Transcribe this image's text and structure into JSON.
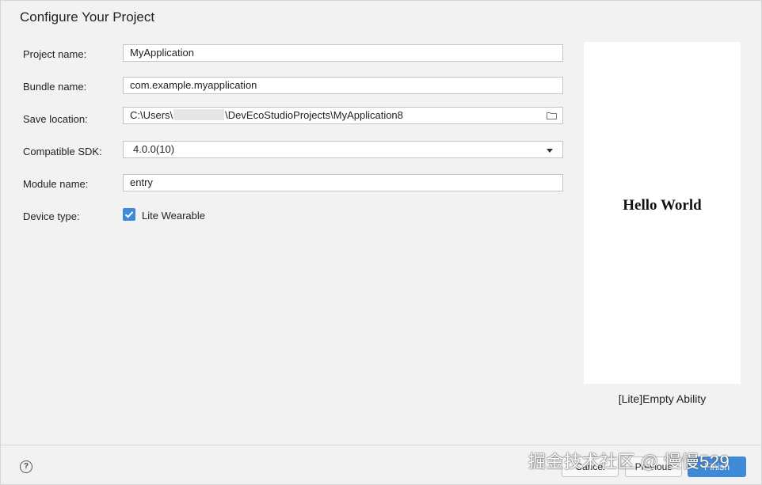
{
  "dialog": {
    "title": "Configure Your Project"
  },
  "form": {
    "project_name": {
      "label": "Project name:",
      "value": "MyApplication"
    },
    "bundle_name": {
      "label": "Bundle name:",
      "value": "com.example.myapplication"
    },
    "save_location": {
      "label": "Save location:",
      "value_prefix": "C:\\Users\\",
      "value_suffix": "\\DevEcoStudioProjects\\MyApplication8"
    },
    "compatible_sdk": {
      "label": "Compatible SDK:",
      "value": "4.0.0(10)"
    },
    "module_name": {
      "label": "Module name:",
      "value": "entry"
    },
    "device_type": {
      "label": "Device type:",
      "option": "Lite Wearable",
      "checked": true
    }
  },
  "preview": {
    "text": "Hello World",
    "caption": "[Lite]Empty Ability"
  },
  "footer": {
    "help": "?",
    "cancel": "Cancel",
    "previous": "Previous",
    "finish": "Finish"
  },
  "watermark": "掘金技术社区 @ 慢慢529",
  "colors": {
    "accent": "#3f8ad8",
    "background": "#f2f2f2"
  },
  "icons": {
    "folder": "folder-icon",
    "dropdown": "chevron-down-icon",
    "check": "check-icon",
    "help": "help-icon"
  }
}
